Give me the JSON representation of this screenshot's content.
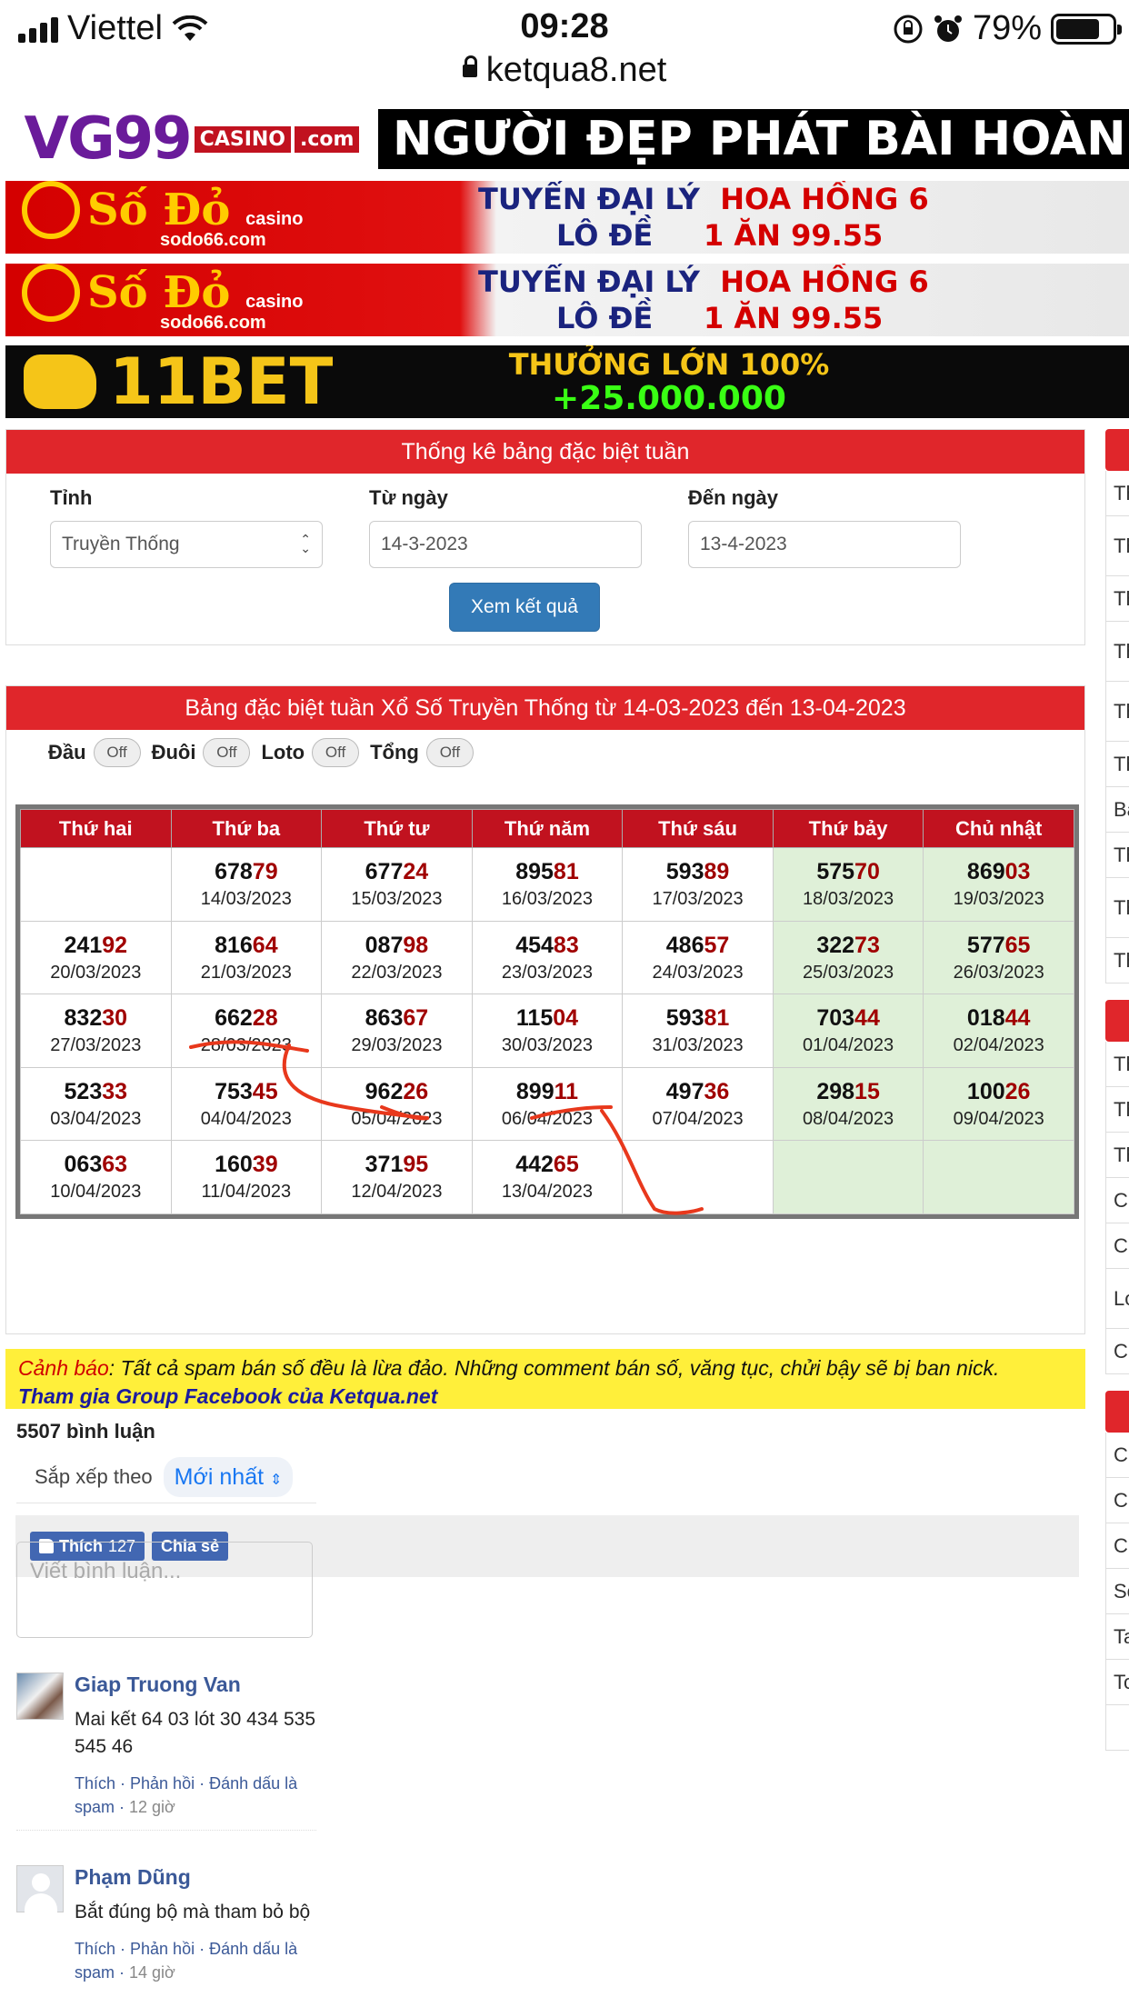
{
  "status": {
    "carrier": "Viettel",
    "time": "09:28",
    "battery": "79%",
    "url": "ketqua8.net"
  },
  "banners": {
    "vg99": {
      "brand": "VG99",
      "dot": ".com",
      "tag": "CASINO",
      "slogan": "NGƯỜI ĐẸP PHÁT BÀI HOÀN"
    },
    "sodo": {
      "brand": "Số Đỏ",
      "tag": "casino",
      "domain": "sodo66.com",
      "line1a": "TUYỂN ĐẠI LÝ",
      "line1b": "HOA HỒNG 6",
      "line2a": "LÔ ĐỀ",
      "line2b": "1 ĂN 99.55"
    },
    "bet": {
      "brand": "11BET",
      "line1": "THƯỞNG LỚN 100%",
      "line2": "+25.000.000"
    }
  },
  "form": {
    "title": "Thống kê bảng đặc biệt tuần",
    "province_label": "Tỉnh",
    "province_value": "Truyền Thống",
    "from_label": "Từ ngày",
    "from_value": "14-3-2023",
    "to_label": "Đến ngày",
    "to_value": "13-4-2023",
    "submit": "Xem kết quả"
  },
  "table": {
    "title": "Bảng đặc biệt tuần Xổ Số Truyền Thống từ 14-03-2023 đến 13-04-2023",
    "toggles": [
      {
        "label": "Đầu",
        "state": "Off"
      },
      {
        "label": "Đuôi",
        "state": "Off"
      },
      {
        "label": "Loto",
        "state": "Off"
      },
      {
        "label": "Tổng",
        "state": "Off"
      }
    ],
    "headers": [
      "Thứ hai",
      "Thứ ba",
      "Thứ tư",
      "Thứ năm",
      "Thứ sáu",
      "Thứ bảy",
      "Chủ nhật"
    ],
    "rows": [
      [
        null,
        {
          "h": "678",
          "t": "79",
          "d": "14/03/2023"
        },
        {
          "h": "677",
          "t": "24",
          "d": "15/03/2023"
        },
        {
          "h": "895",
          "t": "81",
          "d": "16/03/2023"
        },
        {
          "h": "593",
          "t": "89",
          "d": "17/03/2023"
        },
        {
          "h": "575",
          "t": "70",
          "d": "18/03/2023"
        },
        {
          "h": "869",
          "t": "03",
          "d": "19/03/2023"
        }
      ],
      [
        {
          "h": "241",
          "t": "92",
          "d": "20/03/2023"
        },
        {
          "h": "816",
          "t": "64",
          "d": "21/03/2023"
        },
        {
          "h": "087",
          "t": "98",
          "d": "22/03/2023"
        },
        {
          "h": "454",
          "t": "83",
          "d": "23/03/2023"
        },
        {
          "h": "486",
          "t": "57",
          "d": "24/03/2023"
        },
        {
          "h": "322",
          "t": "73",
          "d": "25/03/2023"
        },
        {
          "h": "577",
          "t": "65",
          "d": "26/03/2023"
        }
      ],
      [
        {
          "h": "832",
          "t": "30",
          "d": "27/03/2023"
        },
        {
          "h": "662",
          "t": "28",
          "d": "28/03/2023"
        },
        {
          "h": "863",
          "t": "67",
          "d": "29/03/2023"
        },
        {
          "h": "115",
          "t": "04",
          "d": "30/03/2023"
        },
        {
          "h": "593",
          "t": "81",
          "d": "31/03/2023"
        },
        {
          "h": "703",
          "t": "44",
          "d": "01/04/2023"
        },
        {
          "h": "018",
          "t": "44",
          "d": "02/04/2023"
        }
      ],
      [
        {
          "h": "523",
          "t": "33",
          "d": "03/04/2023"
        },
        {
          "h": "753",
          "t": "45",
          "d": "04/04/2023"
        },
        {
          "h": "962",
          "t": "26",
          "d": "05/04/2023"
        },
        {
          "h": "899",
          "t": "11",
          "d": "06/04/2023"
        },
        {
          "h": "497",
          "t": "36",
          "d": "07/04/2023"
        },
        {
          "h": "298",
          "t": "15",
          "d": "08/04/2023"
        },
        {
          "h": "100",
          "t": "26",
          "d": "09/04/2023"
        }
      ],
      [
        {
          "h": "063",
          "t": "63",
          "d": "10/04/2023"
        },
        {
          "h": "160",
          "t": "39",
          "d": "11/04/2023"
        },
        {
          "h": "371",
          "t": "95",
          "d": "12/04/2023"
        },
        {
          "h": "442",
          "t": "65",
          "d": "13/04/2023"
        },
        null,
        null,
        null
      ]
    ]
  },
  "social": {
    "like": "Thích",
    "like_count": "127",
    "share": "Chia sẻ"
  },
  "warning": {
    "prefix": "Cảnh báo",
    "text": ": Tất cả spam bán số đều là lừa đảo. Những comment bán số, văng tục, chửi bậy sẽ bị ban nick.",
    "link": "Tham gia Group Facebook của Ketqua.net"
  },
  "comments": {
    "count": "5507 bình luận",
    "sort_label": "Sắp xếp theo",
    "sort_value": "Mới nhất",
    "placeholder": "Viết bình luận...",
    "items": [
      {
        "name": "Giap Truong Van",
        "text": "Mai kết 64 03 lót 30 434 535 545 46",
        "actions": "Thích · Phản hồi · Đánh dấu là spam",
        "time": "12 giờ"
      },
      {
        "name": "Phạm Dũng",
        "text": "Bắt đúng bộ mà tham bỏ bộ",
        "actions": "Thích · Phản hồi · Đánh dấu là spam",
        "time": "14 giờ"
      }
    ]
  },
  "sidebar": {
    "items": [
      "Th",
      "Th lo",
      "Th",
      "Th lo",
      "Th",
      "Th",
      "Ba",
      "Th th",
      "Th",
      "Th",
      "Th",
      "Th",
      "Th",
      "C",
      "C V",
      "Lo",
      "C",
      "C",
      "C",
      "C",
      "Sc",
      "Ta",
      "To"
    ]
  },
  "colors": {
    "header_red": "#e0262b",
    "weekend_green": "#dff0d8",
    "tail_red": "#a00000",
    "button_blue": "#337ab7",
    "warning_yellow": "#ffef3a",
    "annotation_red": "#e8381c"
  }
}
